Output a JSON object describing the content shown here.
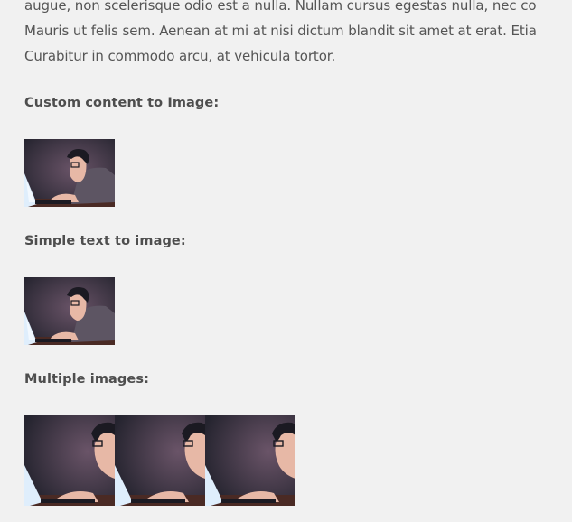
{
  "paragraph": {
    "lines": [
      "augue, non scelerisque odio est a nulla. Nullam cursus egestas nulla, nec co",
      "Mauris ut felis sem. Aenean at mi at nisi dictum blandit sit amet at erat. Etia",
      "Curabitur in commodo arcu, at vehicula tortor."
    ]
  },
  "sections": {
    "custom_content": {
      "heading": "Custom content to Image:"
    },
    "simple_text": {
      "heading": "Simple text to image:"
    },
    "multiple_images": {
      "heading": "Multiple images:"
    }
  },
  "images": {
    "illustration": "person-at-laptop-illustration",
    "colors": {
      "background": "#2b2a36",
      "glow": "#5a4a5e",
      "screen": "#dfeefc",
      "shirt": "#5d5563",
      "skin": "#e7b8a6",
      "hair": "#1b1a22",
      "desk": "#4a2a24"
    }
  }
}
